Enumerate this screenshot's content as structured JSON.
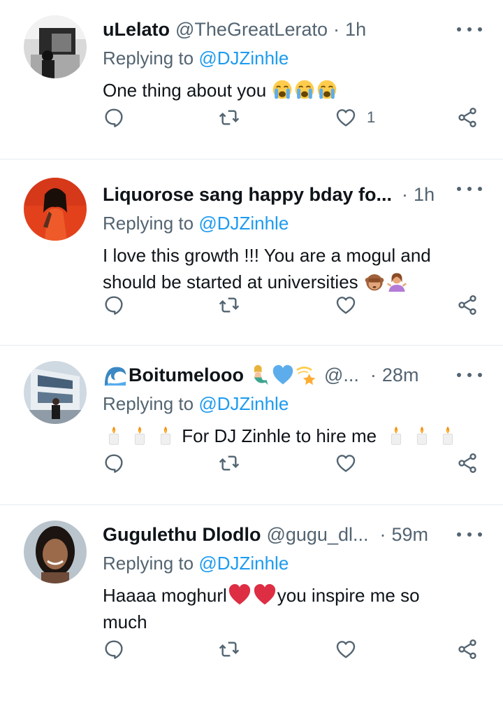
{
  "tweets": [
    {
      "name": "uLelato",
      "handle": "@TheGreatLerato",
      "time": "1h",
      "reply_prefix": "Replying to",
      "reply_to": "@DJZinhle",
      "text_lines": [
        "One thing about you"
      ],
      "trailing_emoji": [
        "loudly-crying-face",
        "loudly-crying-face",
        "loudly-crying-face"
      ],
      "like_count": "1",
      "avatar": "dark-room-photo"
    },
    {
      "name": "Liquorose sang happy bday fo...",
      "handle": "",
      "time": "1h",
      "reply_prefix": "Replying to",
      "reply_to": "@DJZinhle",
      "text_lines": [
        "I love this growth !!! You are a mogul and",
        "should be started at universities"
      ],
      "trailing_emoji": [
        "see-no-evil-monkey",
        "person-shrugging"
      ],
      "like_count": "",
      "avatar": "woman-orange-outfit"
    },
    {
      "name": "Boitumelooo",
      "handle": "@...",
      "time": "28m",
      "reply_prefix": "Replying to",
      "reply_to": "@DJZinhle",
      "text_lines": [
        "For DJ Zinhle to hire me"
      ],
      "leading_emoji": [
        "candle",
        "candle",
        "candle"
      ],
      "trailing_emoji": [
        "candle",
        "candle",
        "candle"
      ],
      "name_emoji": [
        "water-wave",
        "mermaid",
        "blue-heart",
        "dizzy"
      ],
      "like_count": "",
      "avatar": "building-photo"
    },
    {
      "name": "Gugulethu Dlodlo",
      "handle": "@gugu_dl...",
      "time": "59m",
      "reply_prefix": "Replying to",
      "reply_to": "@DJZinhle",
      "text_part1": "Haaaa moghurl",
      "text_part2": "you inspire me so",
      "text_part3": "much",
      "inline_emoji": [
        "red-heart",
        "red-heart"
      ],
      "like_count": "",
      "avatar": "woman-portrait"
    }
  ],
  "colors": {
    "text_primary": "#0f1419",
    "text_secondary": "#536471",
    "mention": "#1d9bf0",
    "divider": "#e6ecf0"
  },
  "icons": {
    "reply": "reply-icon",
    "retweet": "retweet-icon",
    "like": "heart-icon",
    "share": "share-icon",
    "more": "more-icon"
  }
}
